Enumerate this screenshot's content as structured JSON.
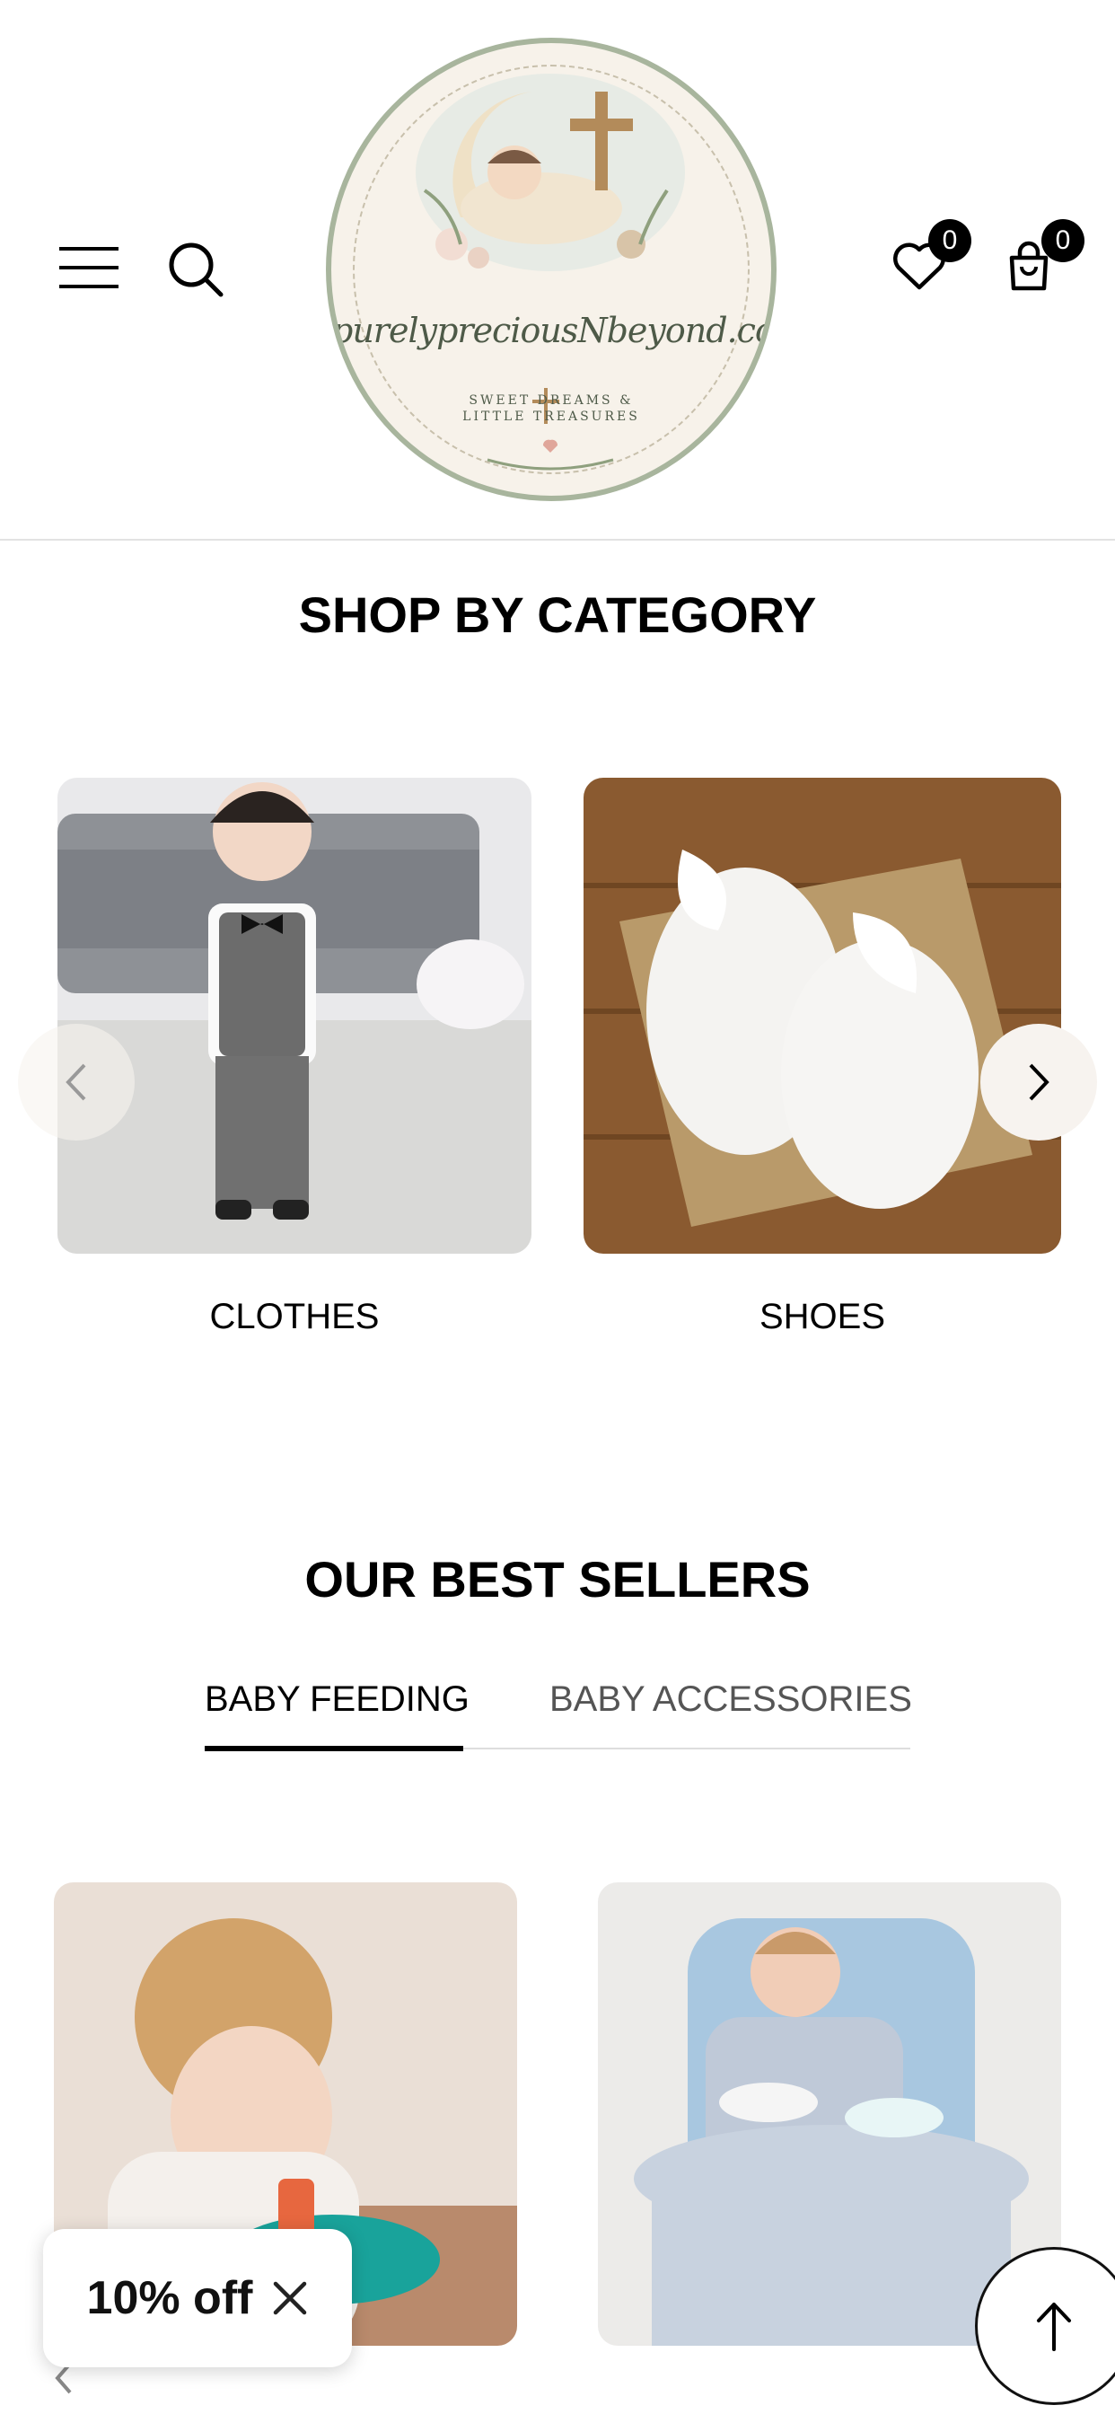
{
  "header": {
    "wishlist_count": "0",
    "cart_count": "0",
    "logo": {
      "brand": "purelypreciousNbeyond.com",
      "tagline_line1": "SWEET DREAMS &",
      "tagline_line2": "LITTLE TREASURES"
    }
  },
  "categories": {
    "title": "SHOP BY CATEGORY",
    "items": [
      {
        "label": "CLOTHES"
      },
      {
        "label": "SHOES"
      }
    ]
  },
  "best_sellers": {
    "title": "OUR BEST SELLERS",
    "tabs": [
      {
        "label": "BABY FEEDING",
        "active": true
      },
      {
        "label": "BABY ACCESSORIES",
        "active": false
      }
    ]
  },
  "popup": {
    "text": "10% off"
  },
  "colors": {
    "accent": "#000000",
    "inactive_tab": "#555555",
    "divider": "#e2e2e2",
    "arrow_bg": "#f7f3ef"
  }
}
